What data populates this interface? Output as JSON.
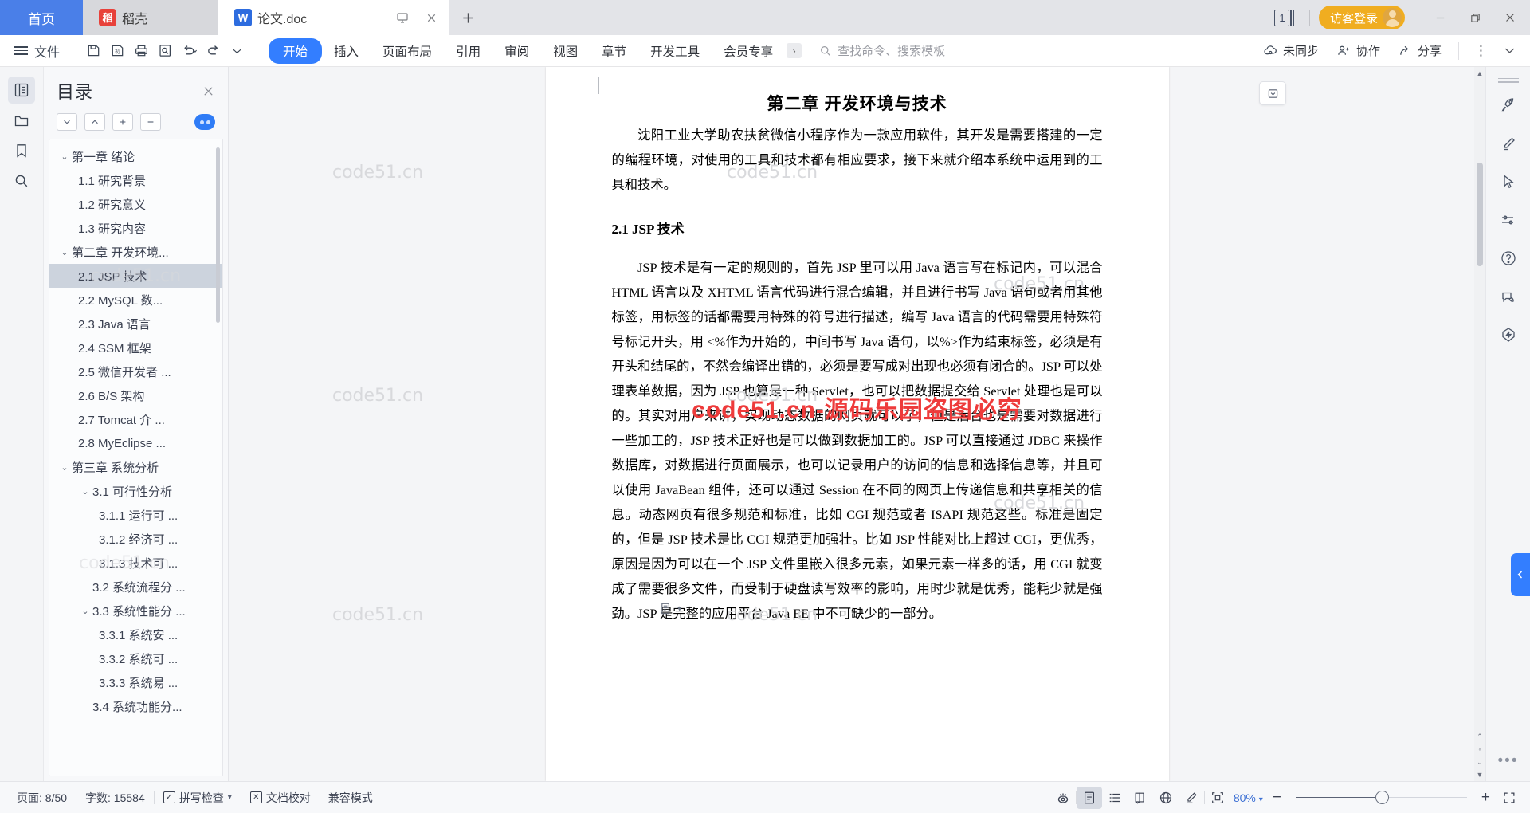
{
  "titlebar": {
    "home_label": "首页",
    "docker_label": "稻壳",
    "doc_tab_label": "论文.doc",
    "new_tab_icon": "plus-icon",
    "page_count": "1",
    "login_label": "访客登录",
    "minimize_icon": "minimize-icon",
    "maximize_icon": "maximize-icon",
    "close_icon": "close-icon"
  },
  "ribbon": {
    "file_label": "文件",
    "quick_icons": [
      "save-icon",
      "save-as-icon",
      "print-icon",
      "print-preview-icon",
      "undo-icon",
      "redo-icon",
      "customize-icon"
    ],
    "tabs": [
      {
        "label": "开始",
        "active": true
      },
      {
        "label": "插入",
        "active": false
      },
      {
        "label": "页面布局",
        "active": false
      },
      {
        "label": "引用",
        "active": false
      },
      {
        "label": "审阅",
        "active": false
      },
      {
        "label": "视图",
        "active": false
      },
      {
        "label": "章节",
        "active": false
      },
      {
        "label": "开发工具",
        "active": false
      },
      {
        "label": "会员专享",
        "active": false
      }
    ],
    "search_placeholder": "查找命令、搜索模板",
    "sync_label": "未同步",
    "collab_label": "协作",
    "share_label": "分享",
    "more_icon": "more-vertical-icon",
    "expand_icon": "chevron-down-icon"
  },
  "left_rail": [
    {
      "name": "toc-icon",
      "active": true
    },
    {
      "name": "folder-icon",
      "active": false
    },
    {
      "name": "bookmark-icon",
      "active": false
    },
    {
      "name": "search-icon",
      "active": false
    }
  ],
  "toc": {
    "title": "目录",
    "close_icon": "close-icon",
    "tools": [
      "chevron-down-icon",
      "chevron-up-icon",
      "plus-icon",
      "minus-icon"
    ],
    "eye_toggle": "eye-toggle-icon",
    "items": [
      {
        "label": "第一章 绪论",
        "level": 1,
        "caret": "v",
        "selected": false
      },
      {
        "label": "1.1 研究背景",
        "level": 2,
        "caret": "",
        "selected": false
      },
      {
        "label": "1.2 研究意义",
        "level": 2,
        "caret": "",
        "selected": false
      },
      {
        "label": "1.3 研究内容",
        "level": 2,
        "caret": "",
        "selected": false
      },
      {
        "label": "第二章 开发环境...",
        "level": 1,
        "caret": "v",
        "selected": false
      },
      {
        "label": "2.1 JSP 技术",
        "level": 2,
        "caret": "",
        "selected": true
      },
      {
        "label": "2.2 MySQL 数...",
        "level": 2,
        "caret": "",
        "selected": false
      },
      {
        "label": "2.3 Java 语言",
        "level": 2,
        "caret": "",
        "selected": false
      },
      {
        "label": "2.4 SSM 框架",
        "level": 2,
        "caret": "",
        "selected": false
      },
      {
        "label": "2.5 微信开发者 ...",
        "level": 2,
        "caret": "",
        "selected": false
      },
      {
        "label": "2.6 B/S 架构",
        "level": 2,
        "caret": "",
        "selected": false
      },
      {
        "label": "2.7 Tomcat 介 ...",
        "level": 2,
        "caret": "",
        "selected": false
      },
      {
        "label": "2.8 MyEclipse ...",
        "level": 2,
        "caret": "",
        "selected": false
      },
      {
        "label": "第三章 系统分析",
        "level": 1,
        "caret": "v",
        "selected": false
      },
      {
        "label": "3.1 可行性分析",
        "level": "2c",
        "caret": "v",
        "selected": false
      },
      {
        "label": "3.1.1 运行可 ...",
        "level": 3,
        "caret": "",
        "selected": false
      },
      {
        "label": "3.1.2 经济可 ...",
        "level": 3,
        "caret": "",
        "selected": false
      },
      {
        "label": "3.1.3 技术可 ...",
        "level": 3,
        "caret": "",
        "selected": false
      },
      {
        "label": "3.2 系统流程分 ...",
        "level": "2c",
        "caret": "",
        "selected": false
      },
      {
        "label": "3.3 系统性能分 ...",
        "level": "2c",
        "caret": "v",
        "selected": false
      },
      {
        "label": "3.3.1 系统安 ...",
        "level": 3,
        "caret": "",
        "selected": false
      },
      {
        "label": "3.3.2 系统可 ...",
        "level": 3,
        "caret": "",
        "selected": false
      },
      {
        "label": "3.3.3 系统易 ...",
        "level": 3,
        "caret": "",
        "selected": false
      },
      {
        "label": "3.4 系统功能分...",
        "level": "2c",
        "caret": "",
        "selected": false
      }
    ]
  },
  "document": {
    "heading1": "第二章 开发环境与技术",
    "para1": "沈阳工业大学助农扶贫微信小程序作为一款应用软件，其开发是需要搭建的一定的编程环境，对使用的工具和技术都有相应要求，接下来就介绍本系统中运用到的工具和技术。",
    "heading2": "2.1 JSP 技术",
    "para2": "JSP 技术是有一定的规则的，首先 JSP 里可以用 Java 语言写在标记内，可以混合 HTML 语言以及 XHTML 语言代码进行混合编辑，并且进行书写 Java 语句或者用其他标签，用标签的话都需要用特殊的符号进行描述，编写 Java 语言的代码需要用特殊符号标记开头，用 <%作为开始的，中间书写 Java 语句，以%>作为结束标签，必须是有开头和结尾的，不然会编译出错的，必须是要写成对出现也必须有闭合的。JSP 可以处理表单数据，因为 JSP 也算是一种 Servlet，也可以把数据提交给 Servlet 处理也是可以的。其实对用户来讲，实现动态数据的网页就可以了，但是后台也是需要对数据进行一些加工的，JSP 技术正好也是可以做到数据加工的。JSP 可以直接通过 JDBC 来操作数据库，对数据进行页面展示，也可以记录用户的访问的信息和选择信息等，并且可以使用 JavaBean 组件，还可以通过 Session 在不同的网页上传递信息和共享相关的信息。动态网页有很多规范和标准，比如 CGI 规范或者 ISAPI 规范这些。标准是固定的，但是 JSP 技术是比 CGI 规范更加强壮。比如 JSP 性能对比上超过 CGI，更优秀，原因是因为可以在一个 JSP 文件里嵌入很多元素，如果元素一样多的话，用 CGI 就变成了需要很多文件，而受制于硬盘读写效率的影响，用时少就是优秀，能耗少就是强劲。JSP 是完整的应用平台 Java EE 中不可缺少的一部分。",
    "watermark_text": "code51.cn",
    "watermark_red": "code51.cn-源码乐园盗图必穷",
    "paste_icon": "paste-options-icon"
  },
  "right_rail": [
    {
      "name": "rocket-icon"
    },
    {
      "name": "brush-icon"
    },
    {
      "name": "cursor-icon"
    },
    {
      "name": "sliders-icon"
    },
    {
      "name": "help-icon"
    },
    {
      "name": "feedback-icon"
    },
    {
      "name": "lightning-icon"
    }
  ],
  "collapse_tab_icon": "chevron-left-icon",
  "status": {
    "page_label": "页面: 8/50",
    "word_count_label": "字数: 15584",
    "spellcheck_label": "拼写检查",
    "proofread_label": "文档校对",
    "compat_label": "兼容模式",
    "view_icons": [
      "focus-eye-icon",
      "page-view-icon",
      "outline-view-icon",
      "read-view-icon",
      "web-view-icon",
      "edit-pen-icon"
    ],
    "fit_icon": "fit-page-icon",
    "zoom_label": "80%",
    "zoom_out_icon": "minus-icon",
    "zoom_in_icon": "plus-icon",
    "fullscreen_icon": "fullscreen-icon"
  },
  "colors": {
    "accent_blue": "#337eff",
    "title_blue": "#4a7fe8",
    "login_orange": "#f0ad20",
    "watermark_red": "#ee3b3b",
    "selection_gray": "#ccd3dd"
  }
}
